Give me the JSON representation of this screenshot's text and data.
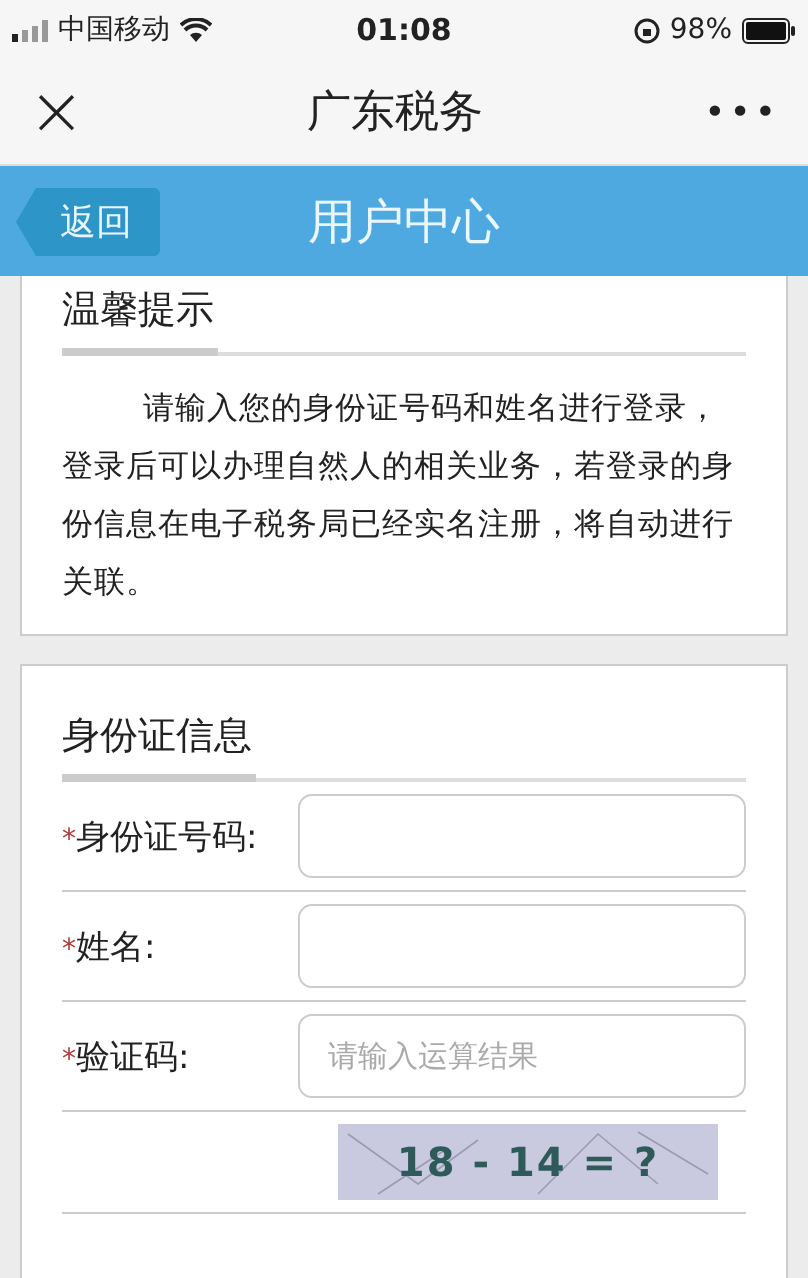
{
  "status_bar": {
    "carrier": "中国移动",
    "time": "01:08",
    "battery": "98%"
  },
  "nav_bar": {
    "close": "×",
    "title": "广东税务",
    "more": "•••"
  },
  "header": {
    "back": "返回",
    "title": "用户中心"
  },
  "tips": {
    "title": "温馨提示",
    "text": "请输入您的身份证号码和姓名进行登录，登录后可以办理自然人的相关业务，若登录的身份信息在电子税务局已经实名注册，将自动进行关联。"
  },
  "id_form": {
    "title": "身份证信息",
    "fields": [
      {
        "required_mark": "*",
        "label": "身份证号码:"
      },
      {
        "required_mark": "*",
        "label": "姓名:"
      },
      {
        "required_mark": "*",
        "label": "验证码:",
        "placeholder": "请输入运算结果"
      }
    ],
    "captcha": "18 - 14 = ?"
  }
}
